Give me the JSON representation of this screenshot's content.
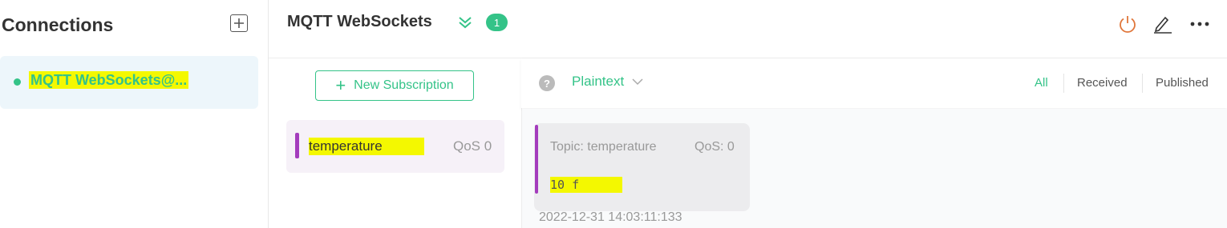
{
  "sidebar": {
    "title": "Connections",
    "connections": [
      {
        "name": "MQTT WebSockets@...",
        "status": "connected"
      }
    ]
  },
  "header": {
    "title": "MQTT WebSockets",
    "subscription_count": "1"
  },
  "subscriptions": {
    "new_button_label": "New Subscription",
    "items": [
      {
        "topic": "temperature",
        "qos": "QoS 0",
        "color": "#a43cbd"
      }
    ]
  },
  "toolbar": {
    "format": "Plaintext",
    "help": "?",
    "filters": [
      "All",
      "Received",
      "Published"
    ],
    "active_filter": "All"
  },
  "messages": [
    {
      "topic": "Topic: temperature",
      "qos": "QoS: 0",
      "payload": "10 f",
      "time": "2022-12-31 14:03:11:133"
    }
  ],
  "colors": {
    "accent": "#34c388",
    "highlight": "#f4f800",
    "topic_color": "#a43cbd",
    "power": "#e0763a"
  },
  "icons": [
    "plus-square-icon",
    "double-chevron-down-icon",
    "power-icon",
    "edit-icon",
    "more-icon",
    "help-icon",
    "chevron-down-icon",
    "plus-icon"
  ]
}
